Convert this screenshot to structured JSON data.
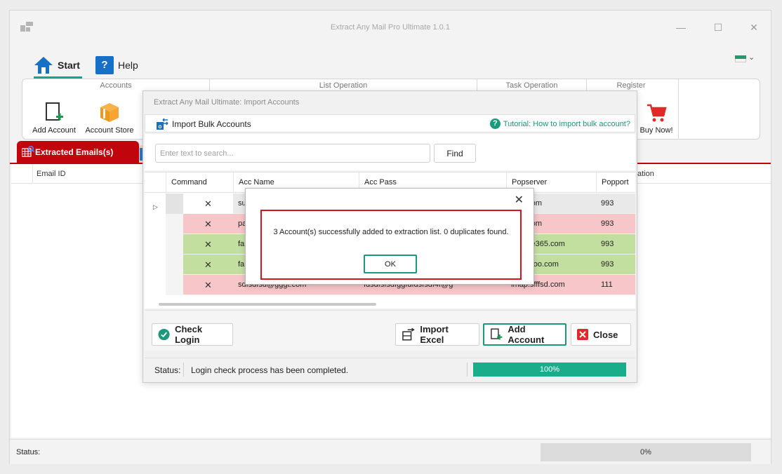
{
  "window": {
    "title": "Extract Any Mail Pro Ultimate 1.0.1",
    "minimize_glyph": "—",
    "maximize_glyph": "☐",
    "close_glyph": "✕"
  },
  "ribbon_tabs": {
    "start": "Start",
    "help": "Help",
    "help_glyph": "?"
  },
  "ribbon": {
    "groups": {
      "accounts": "Accounts",
      "list_operation": "List Operation",
      "task_operation": "Task Operation",
      "register": "Register"
    },
    "buttons": {
      "add_account": "Add Account",
      "account_store": "Account Store",
      "buy_now": "Buy Now!"
    }
  },
  "workspace": {
    "tab_extracted": "Extracted Emails(s)",
    "col_email_id": "Email ID",
    "col_right_partial": "ation"
  },
  "main_status": {
    "label": "Status:",
    "progress_text": "0%"
  },
  "import_dialog": {
    "title": "Extract Any Mail Ultimate: Import Accounts",
    "header_label": "Import Bulk Accounts",
    "tutorial": "Tutorial: How to import bulk account?",
    "tutorial_glyph": "?",
    "search_placeholder": "Enter text to search...",
    "find": "Find",
    "columns": [
      "Command",
      "Acc Name",
      "Acc Pass",
      "Popserver",
      "Popport"
    ],
    "rows": [
      {
        "cmd": "✕",
        "name": "su",
        "pass": "",
        "server": "mail.com",
        "port": "993",
        "style": "gray"
      },
      {
        "cmd": "✕",
        "name": "pa",
        "pass": "",
        "server": "mail.com",
        "port": "993",
        "style": "pink"
      },
      {
        "cmd": "✕",
        "name": "fa",
        "pass": "",
        "server": "c.office365.com",
        "port": "993",
        "style": "green"
      },
      {
        "cmd": "✕",
        "name": "fa",
        "pass": "",
        "server": "ail.yahoo.com",
        "port": "993",
        "style": "green"
      },
      {
        "cmd": "✕",
        "name": "sdfsdfsd@gggt.com",
        "pass": "fdsdfsfsdfggfdfdsfsdf4f@g",
        "server": "imap.sfffsd.com",
        "port": "111",
        "style": "pink"
      }
    ],
    "row_pointer": "▷",
    "buttons": {
      "check_login": "Check Login",
      "import_excel": "Import Excel",
      "add_account": "Add Account",
      "close": "Close"
    },
    "status_label": "Status:",
    "status_text": "Login check process has been completed.",
    "progress": 100,
    "progress_text": "100%"
  },
  "message_box": {
    "text": "3 Account(s) successfully added to extraction list. 0 duplicates found.",
    "ok": "OK",
    "close_glyph": "✕"
  },
  "colors": {
    "accent": "#19a589",
    "extracted_tab": "#c0060c",
    "row_pink": "#f6c6c8",
    "row_green": "#c3dfa0",
    "highlight_border": "#d9131b"
  }
}
